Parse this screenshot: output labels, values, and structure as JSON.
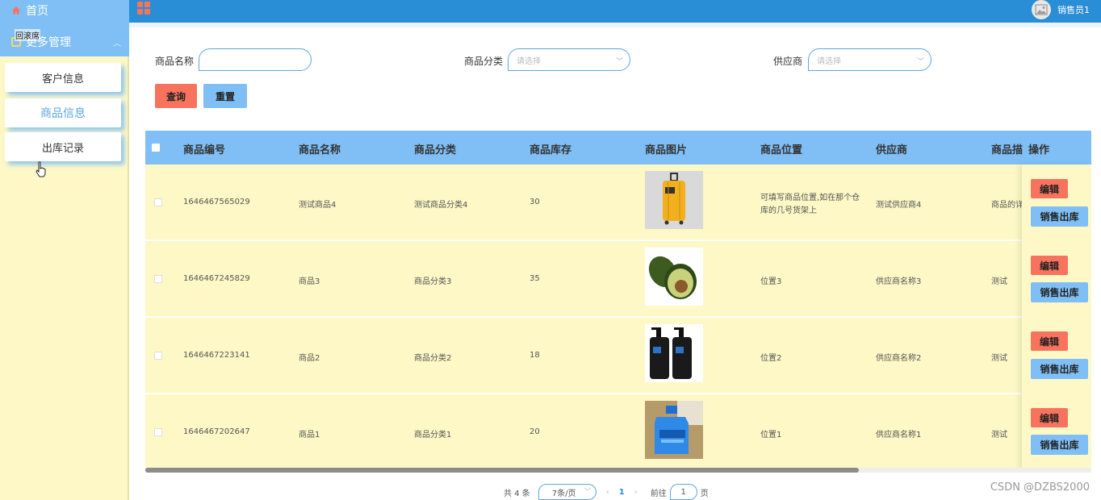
{
  "sidebar": {
    "home_label": "首页",
    "more_label": "更多管理",
    "tooltip_label": "回滚席",
    "items": [
      {
        "label": "客户信息"
      },
      {
        "label": "商品信息"
      },
      {
        "label": "出库记录"
      }
    ]
  },
  "header": {
    "user_name": "销售员1"
  },
  "search": {
    "name_label": "商品名称",
    "name_value": "",
    "category_label": "商品分类",
    "category_placeholder": "请选择",
    "supplier_label": "供应商",
    "supplier_placeholder": "请选择",
    "query_button": "查询",
    "reset_button": "重置"
  },
  "table": {
    "headers": {
      "code": "商品编号",
      "name": "商品名称",
      "category": "商品分类",
      "stock": "商品库存",
      "image": "商品图片",
      "location": "商品位置",
      "supplier": "供应商",
      "desc": "商品描",
      "ops": "操作"
    },
    "rows": [
      {
        "code": "1646467565029",
        "name": "测试商品4",
        "category": "测试商品分类4",
        "stock": "30",
        "image_icon": "suitcase-image",
        "location_line1": "可填写商品位置,如在那个仓",
        "location_line2": "库的几号货架上",
        "supplier": "测试供应商4",
        "desc": "商品的详"
      },
      {
        "code": "1646467245829",
        "name": "商品3",
        "category": "商品分类3",
        "stock": "35",
        "image_icon": "avocado-image",
        "location_line1": "位置3",
        "location_line2": "",
        "supplier": "供应商名称3",
        "desc": "测试"
      },
      {
        "code": "1646467223141",
        "name": "商品2",
        "category": "商品分类2",
        "stock": "18",
        "image_icon": "lotion-bottles-image",
        "location_line1": "位置2",
        "location_line2": "",
        "supplier": "供应商名称2",
        "desc": "测试"
      },
      {
        "code": "1646467202647",
        "name": "商品1",
        "category": "商品分类1",
        "stock": "20",
        "image_icon": "detergent-bottle-image",
        "location_line1": "位置1",
        "location_line2": "",
        "supplier": "供应商名称1",
        "desc": "测试"
      }
    ],
    "edit_label": "编辑",
    "out_label": "销售出库"
  },
  "pagination": {
    "total_text": "共 4 条",
    "page_size": "7条/页",
    "prev": "‹",
    "current_page": "1",
    "next": "›",
    "goto_label": "前往",
    "goto_value": "1",
    "page_suffix": "页"
  },
  "watermark": "CSDN @DZBS2000",
  "colors": {
    "sidebar_bg": "#fdf8c6",
    "accent_blue": "#7fbff5",
    "header_blue": "#2a8ed6",
    "accent_red": "#f7735e"
  }
}
